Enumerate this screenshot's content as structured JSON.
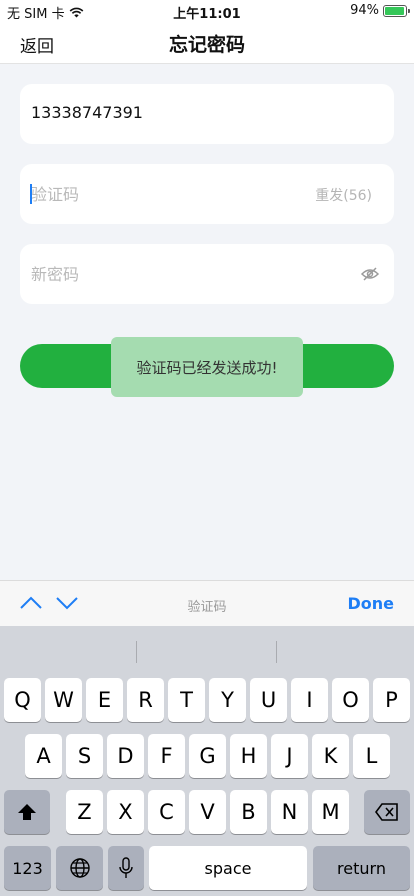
{
  "status_bar": {
    "carrier": "无 SIM 卡",
    "time": "上午11:01",
    "battery_text": "94%",
    "battery_level": 0.94
  },
  "nav": {
    "back_label": "返回",
    "title": "忘记密码"
  },
  "form": {
    "phone_value": "13338747391",
    "code_placeholder": "验证码",
    "resend_label": "重发(56)",
    "password_placeholder": "新密码"
  },
  "toast": {
    "message": "验证码已经发送成功!"
  },
  "accessory": {
    "field_label": "验证码",
    "done_label": "Done"
  },
  "keyboard": {
    "row1": [
      "Q",
      "W",
      "E",
      "R",
      "T",
      "Y",
      "U",
      "I",
      "O",
      "P"
    ],
    "row2": [
      "A",
      "S",
      "D",
      "F",
      "G",
      "H",
      "J",
      "K",
      "L"
    ],
    "row3": [
      "Z",
      "X",
      "C",
      "V",
      "B",
      "N",
      "M"
    ],
    "numbers_label": "123",
    "space_label": "space",
    "return_label": "return"
  },
  "colors": {
    "accent": "#1e7ef5",
    "primary_button": "#22b03f",
    "toast_bg": "#a5dcb0"
  }
}
